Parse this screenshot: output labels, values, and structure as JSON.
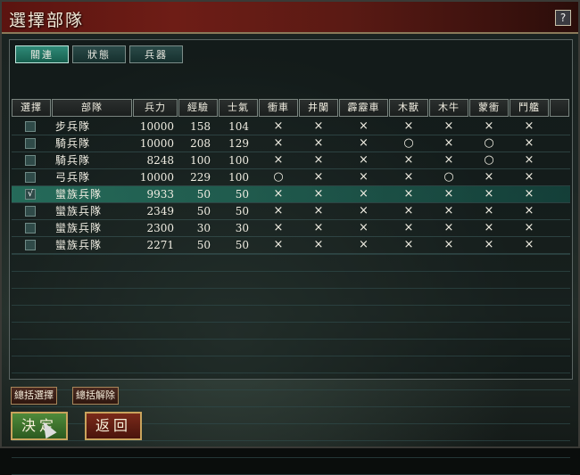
{
  "window": {
    "title": "選擇部隊",
    "help_label": "?"
  },
  "tabs": [
    {
      "label": "關連"
    },
    {
      "label": "狀態"
    },
    {
      "label": "兵器"
    }
  ],
  "table": {
    "headers": [
      "選擇",
      "部隊",
      "兵力",
      "經驗",
      "士氣",
      "衝車",
      "井闌",
      "霹靂車",
      "木獸",
      "木牛",
      "蒙衝",
      "鬥艦"
    ],
    "rows": [
      {
        "selected": false,
        "check": "",
        "name": "步兵隊",
        "troops": "10000",
        "exp": "158",
        "morale": "104",
        "marks": [
          "×",
          "×",
          "×",
          "×",
          "×",
          "×",
          "×"
        ]
      },
      {
        "selected": false,
        "check": "",
        "name": "騎兵隊",
        "troops": "10000",
        "exp": "208",
        "morale": "129",
        "marks": [
          "×",
          "×",
          "×",
          "○",
          "×",
          "○",
          "×"
        ]
      },
      {
        "selected": false,
        "check": "",
        "name": "騎兵隊",
        "troops": "8248",
        "exp": "100",
        "morale": "100",
        "marks": [
          "×",
          "×",
          "×",
          "×",
          "×",
          "○",
          "×"
        ]
      },
      {
        "selected": false,
        "check": "",
        "name": "弓兵隊",
        "troops": "10000",
        "exp": "229",
        "morale": "100",
        "marks": [
          "○",
          "×",
          "×",
          "×",
          "○",
          "×",
          "×"
        ]
      },
      {
        "selected": true,
        "check": "√",
        "name": "蠻族兵隊",
        "troops": "9933",
        "exp": "50",
        "morale": "50",
        "marks": [
          "×",
          "×",
          "×",
          "×",
          "×",
          "×",
          "×"
        ]
      },
      {
        "selected": false,
        "check": "",
        "name": "蠻族兵隊",
        "troops": "2349",
        "exp": "50",
        "morale": "50",
        "marks": [
          "×",
          "×",
          "×",
          "×",
          "×",
          "×",
          "×"
        ]
      },
      {
        "selected": false,
        "check": "",
        "name": "蠻族兵隊",
        "troops": "2300",
        "exp": "30",
        "morale": "30",
        "marks": [
          "×",
          "×",
          "×",
          "×",
          "×",
          "×",
          "×"
        ]
      },
      {
        "selected": false,
        "check": "",
        "name": "蠻族兵隊",
        "troops": "2271",
        "exp": "50",
        "morale": "50",
        "marks": [
          "×",
          "×",
          "×",
          "×",
          "×",
          "×",
          "×"
        ]
      }
    ]
  },
  "buttons": {
    "select_all": "總括選擇",
    "deselect_all": "總括解除",
    "ok": "決定",
    "back": "返回"
  },
  "colors": {
    "title_bar": "#6e1d16",
    "selected_row": "#1f7a66",
    "ok_button": "#4f8a3a",
    "back_button": "#7a2a1a"
  }
}
